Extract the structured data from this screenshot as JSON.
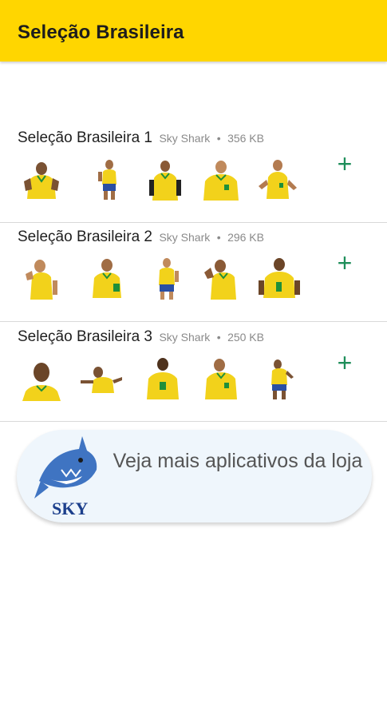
{
  "appbar": {
    "title": "Seleção Brasileira"
  },
  "packs": [
    {
      "name": "Seleção Brasileira 1",
      "author": "Sky Shark",
      "size": "356 KB",
      "add_label": "+"
    },
    {
      "name": "Seleção Brasileira 2",
      "author": "Sky Shark",
      "size": "296 KB",
      "add_label": "+"
    },
    {
      "name": "Seleção Brasileira 3",
      "author": "Sky Shark",
      "size": "250 KB",
      "add_label": "+"
    }
  ],
  "meta_separator": "•",
  "promo": {
    "text": "Veja mais aplicativos da loja",
    "logo_text": "SKY"
  },
  "colors": {
    "appbar": "#ffd600",
    "add_icon": "#1e8e5a",
    "jersey_yellow": "#f2d21b",
    "jersey_green": "#1f8f3a",
    "shorts_blue": "#2a4fa3",
    "skin": "#9a6a44"
  }
}
